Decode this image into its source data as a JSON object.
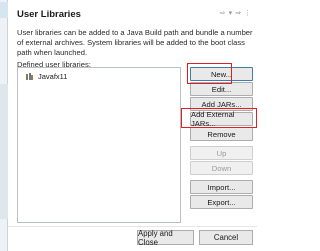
{
  "section": {
    "title": "User Libraries",
    "description": "User libraries can be added to a Java Build path and bundle a number of external archives. System libraries will be added to the boot class path when launched.",
    "list_label": "Defined user libraries:"
  },
  "libraries": [
    {
      "name": "Javafx11",
      "icon": "library-icon"
    }
  ],
  "header_tools": {
    "back_icon": "back-arrow-icon",
    "back_menu_icon": "chevron-down-icon",
    "forward_icon": "forward-arrow-icon",
    "menu_icon": "view-menu-icon"
  },
  "buttons": {
    "new": "New...",
    "edit": "Edit...",
    "add_jars": "Add JARs...",
    "add_external_jars": "Add External JARs...",
    "remove": "Remove",
    "up": "Up",
    "down": "Down",
    "import": "Import...",
    "export": "Export..."
  },
  "footer": {
    "apply_and_close": "Apply and Close",
    "cancel": "Cancel"
  },
  "colors": {
    "annotation_red": "#e02020",
    "button_bg": "#e9e9e9",
    "disabled_text": "#9a9a9a"
  }
}
